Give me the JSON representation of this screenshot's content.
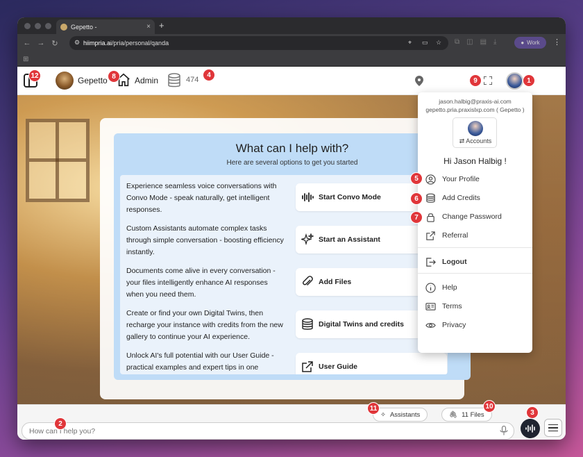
{
  "browser": {
    "tab_title": "Gepetto -",
    "tab_close": "×",
    "new_tab": "+",
    "url_host": "hiimpria.ai",
    "url_path": "/pria/personal/qanda",
    "profile_label": "Work"
  },
  "header": {
    "twin_name": "Gepetto",
    "role_label": "Admin",
    "credits": "474"
  },
  "help": {
    "title": "What can I help with?",
    "subtitle": "Here are several options to get you started",
    "options": [
      {
        "text": "Experience seamless voice conversations with Convo Mode - speak naturally, get intelligent responses.",
        "button": "Start Convo Mode",
        "icon": "waveform-icon"
      },
      {
        "text": "Custom Assistants automate complex tasks through simple conversation - boosting efficiency instantly.",
        "button": "Start an Assistant",
        "icon": "sparkles-icon"
      },
      {
        "text": "Documents come alive in every conversation - your files intelligently enhance AI responses when you need them.",
        "button": "Add Files",
        "icon": "paperclip-icon"
      },
      {
        "text": "Create or find your own Digital Twins, then recharge your instance with credits from the new gallery to continue your AI experience.",
        "button": "Digital Twins and credits",
        "icon": "database-icon"
      },
      {
        "text": "Unlock AI's full potential with our User Guide - practical examples and expert tips in one",
        "button": "User Guide",
        "icon": "external-link-icon"
      }
    ]
  },
  "menu": {
    "email": "jason.halbig@praxis-ai.com",
    "instance": "gepetto.pria.praxislxp.com ( Gepetto )",
    "accounts_label": "⇄ Accounts",
    "greeting": "Hi Jason Halbig !",
    "items": {
      "profile": "Your Profile",
      "add_credits": "Add Credits",
      "change_password": "Change Password",
      "referral": "Referral",
      "logout": "Logout",
      "help": "Help",
      "terms": "Terms",
      "privacy": "Privacy"
    }
  },
  "bottom": {
    "assistants_label": "Assistants",
    "files_label": "11 Files",
    "input_placeholder": "How can I help you?"
  },
  "badges": [
    "1",
    "2",
    "3",
    "4",
    "5",
    "6",
    "7",
    "8",
    "9",
    "10",
    "11",
    "12"
  ],
  "colors": {
    "badge": "#e0363a",
    "help_panel": "#bfdcf7",
    "voice_button": "#1f2430"
  }
}
